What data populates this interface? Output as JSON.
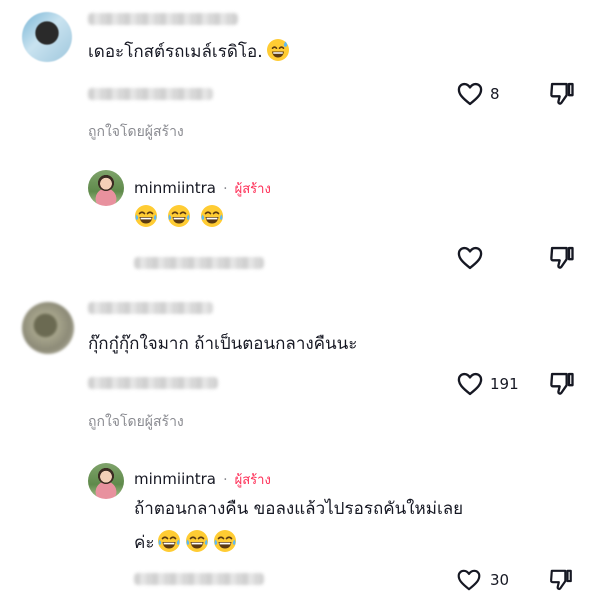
{
  "comments": [
    {
      "text": "เดอะโกสต์รถเมล์เรดิโอ.",
      "like_count": "8",
      "liked_by_creator": "ถูกใจโดยผู้สร้าง",
      "reply": {
        "username": "minmiintra",
        "separator": "·",
        "badge": "ผู้สร้าง",
        "text": "😂😂😂"
      }
    },
    {
      "text": "กุ๊กกู๋กุ๊กใจมาก ถ้าเป็นตอนกลางคืนนะ",
      "like_count": "191",
      "liked_by_creator": "ถูกใจโดยผู้สร้าง",
      "reply": {
        "username": "minmiintra",
        "separator": "·",
        "badge": "ผู้สร้าง",
        "text_line1": "ถ้าตอนกลางคืน ขอลงแล้วไปรอรถคันใหม่เลย",
        "text_line2": "ค่ะ",
        "like_count": "30"
      }
    }
  ],
  "colors": {
    "creator_badge": "#fe2c55",
    "muted": "#8a8b91"
  }
}
